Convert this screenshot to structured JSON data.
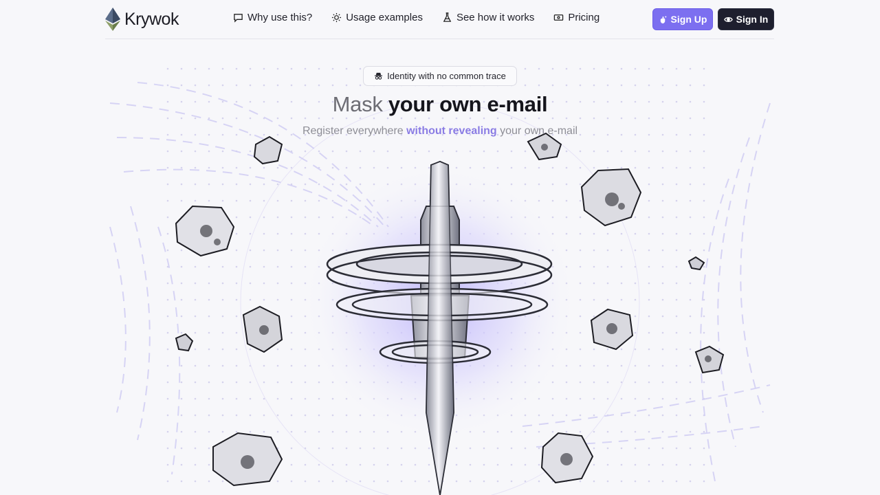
{
  "brand": {
    "name": "Krywok",
    "logo_icon": "ethereum-diamond-icon"
  },
  "nav": [
    {
      "label": "Why use this?",
      "icon": "chat-bubble-icon"
    },
    {
      "label": "Usage examples",
      "icon": "lightbulb-icon"
    },
    {
      "label": "See how it works",
      "icon": "flask-icon"
    },
    {
      "label": "Pricing",
      "icon": "ticket-icon"
    }
  ],
  "actions": {
    "signup_label": "Sign Up",
    "signup_icon": "sparkle-hand-icon",
    "signin_label": "Sign In",
    "signin_icon": "eye-icon"
  },
  "hero": {
    "badge_icon": "incognito-icon",
    "badge_text": "Identity with no common trace",
    "headline_soft": "Mask",
    "headline_rest": " your own e-mail",
    "sub_before": "Register everywhere ",
    "sub_accent": "without revealing",
    "sub_after": " your own e-mail"
  },
  "colors": {
    "accent": "#7c6ff0",
    "dark_button": "#1e1f2e",
    "background": "#f7f7fa",
    "glow": "#c6bffa"
  }
}
